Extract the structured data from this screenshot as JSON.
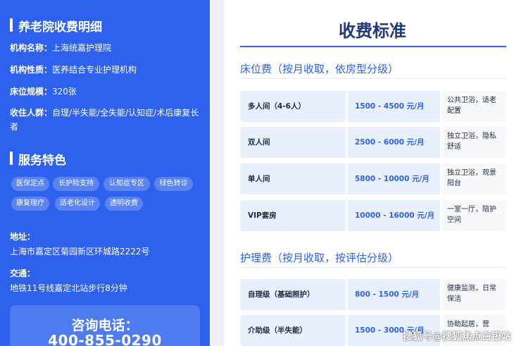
{
  "sidebar": {
    "detail_title": "养老院收费明细",
    "info": [
      {
        "label": "机构名称：",
        "value": "上海统嘉护理院"
      },
      {
        "label": "机构性质：",
        "value": "医养结合专业护理机构"
      },
      {
        "label": "床位规模：",
        "value": "320张"
      },
      {
        "label": "收住人群：",
        "value": "自理/半失能/全失能/认知症/术后康复长者"
      }
    ],
    "features_title": "服务特色",
    "tags": [
      "医保定点",
      "长护险支持",
      "认知症专区",
      "绿色转诊",
      "康复理疗",
      "适老化设计",
      "透明收费"
    ],
    "address_label": "地址：",
    "address_value": "上海市嘉定区菊园新区环城路2222号",
    "transport_label": "交通：",
    "transport_value": "地铁11号线嘉定北站步行8分钟",
    "consult_label": "咨询电话：",
    "consult_phone": "400-855-0290"
  },
  "main": {
    "title": "收费标准",
    "bed_fee_title": "床位费（按月收取，依房型分级）",
    "bed_rows": [
      {
        "type": "多人间（4-6人）",
        "price": "1500 - 4500 元/月",
        "desc": "公共卫浴，适老配置"
      },
      {
        "type": "双人间",
        "price": "2500 - 6000 元/月",
        "desc": "独立卫浴，隐私舒适"
      },
      {
        "type": "单人间",
        "price": "5800 - 10000 元/月",
        "desc": "独立卫浴，观景阳台"
      },
      {
        "type": "VIP套房",
        "price": "10000 - 16000 元/月",
        "desc": "一室一厅，陪护空间"
      }
    ],
    "care_fee_title": "护理费（按月收取，按评估分级）",
    "care_rows": [
      {
        "type": "自理级（基础照护）",
        "price": "800 - 1500 元/月",
        "desc": "健康监测，日常保洁"
      },
      {
        "type": "介助级（半失能）",
        "price": "1500 - 3000 元/月",
        "desc": "协助起居，营"
      }
    ]
  },
  "watermark": "搜狐号@搜狐焦点白银站"
}
